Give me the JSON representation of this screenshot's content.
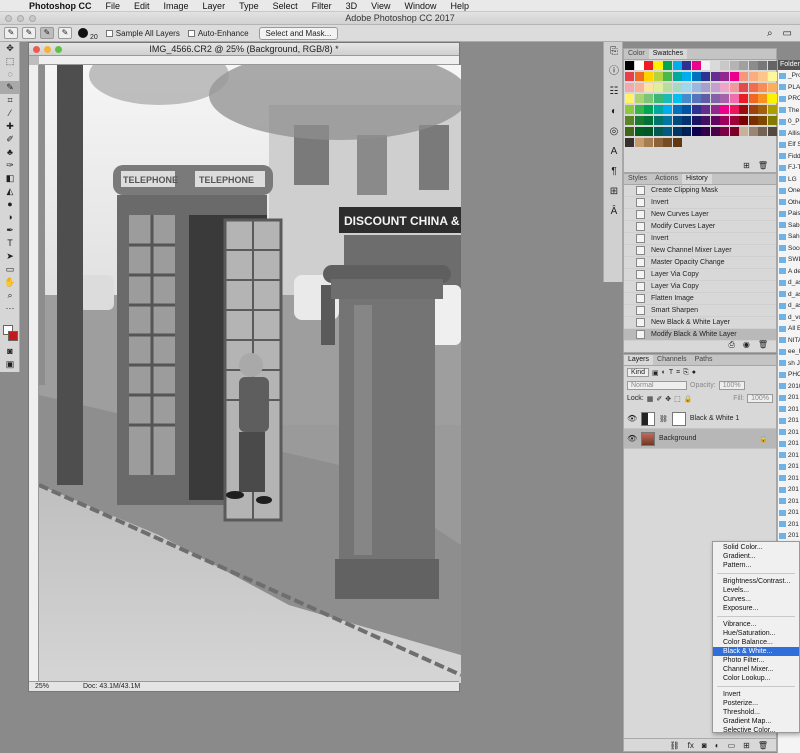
{
  "menubar": {
    "app_name": "Photoshop CC",
    "items": [
      "File",
      "Edit",
      "Image",
      "Layer",
      "Type",
      "Select",
      "Filter",
      "3D",
      "View",
      "Window",
      "Help"
    ]
  },
  "app_title": "Adobe Photoshop CC 2017",
  "options_bar": {
    "brush_size": "20",
    "sample_all_layers": "Sample All Layers",
    "auto_enhance": "Auto-Enhance",
    "select_and_mask": "Select and Mask..."
  },
  "document": {
    "title": "IMG_4566.CR2 @ 25% (Background, RGB/8) *",
    "zoom": "25%",
    "doc_size": "Doc: 43.1M/43.1M",
    "photo_signs": {
      "telephone_left": "TELEPHONE",
      "telephone_right": "TELEPHONE",
      "shop": "DISCOUNT CHINA &"
    }
  },
  "swatches_panel": {
    "tabs": [
      "Color",
      "Swatches"
    ],
    "active_tab": "Swatches"
  },
  "history_panel": {
    "tabs": [
      "Styles",
      "Actions",
      "History"
    ],
    "active_tab": "History",
    "items": [
      "Create Clipping Mask",
      "Invert",
      "New Curves Layer",
      "Modify Curves Layer",
      "Invert",
      "New Channel Mixer Layer",
      "Master Opacity Change",
      "Layer Via Copy",
      "Layer Via Copy",
      "Flatten Image",
      "Smart Sharpen",
      "New Black & White Layer",
      "Modify Black & White Layer"
    ],
    "selected_index": 12
  },
  "layers_panel": {
    "tabs": [
      "Layers",
      "Channels",
      "Paths"
    ],
    "active_tab": "Layers",
    "filter": "Kind",
    "blend_mode": "Normal",
    "opacity_label": "Opacity:",
    "opacity_value": "100%",
    "lock_label": "Lock:",
    "fill_label": "Fill:",
    "fill_value": "100%",
    "layers": [
      {
        "name": "Black & White 1",
        "selected": false
      },
      {
        "name": "Background",
        "selected": true
      }
    ]
  },
  "folders_panel": {
    "title": "Folders",
    "items": [
      "_Projects",
      "PLANNED",
      "PROJECTS",
      "The Lib",
      "0_POL",
      "Allison",
      "Elf Sa",
      "Fiddle",
      "FJ-TN",
      "LG",
      "One L",
      "Other",
      "Paisle",
      "Sabrin",
      "Sahlin",
      "Socc",
      "SWL",
      "A design",
      "d_astor",
      "d_astory",
      "d_astor",
      "d_voyag",
      "All Edwar",
      "NITA D",
      "ee_here",
      "sh Jobli",
      "PHOTO",
      "2010",
      "201",
      "201",
      "201",
      "201",
      "201",
      "201",
      "201",
      "201",
      "201",
      "201",
      "201",
      "201",
      "201",
      "Jo",
      "NA",
      "Nic",
      "2011",
      "2012",
      "2013",
      "2014",
      "2015",
      "2016"
    ]
  },
  "adjustment_menu": {
    "groups": [
      [
        "Solid Color...",
        "Gradient...",
        "Pattern..."
      ],
      [
        "Brightness/Contrast...",
        "Levels...",
        "Curves...",
        "Exposure..."
      ],
      [
        "Vibrance...",
        "Hue/Saturation...",
        "Color Balance...",
        "Black & White...",
        "Photo Filter...",
        "Channel Mixer...",
        "Color Lookup..."
      ],
      [
        "Invert",
        "Posterize...",
        "Threshold...",
        "Gradient Map...",
        "Selective Color..."
      ]
    ],
    "selected": "Black & White..."
  }
}
